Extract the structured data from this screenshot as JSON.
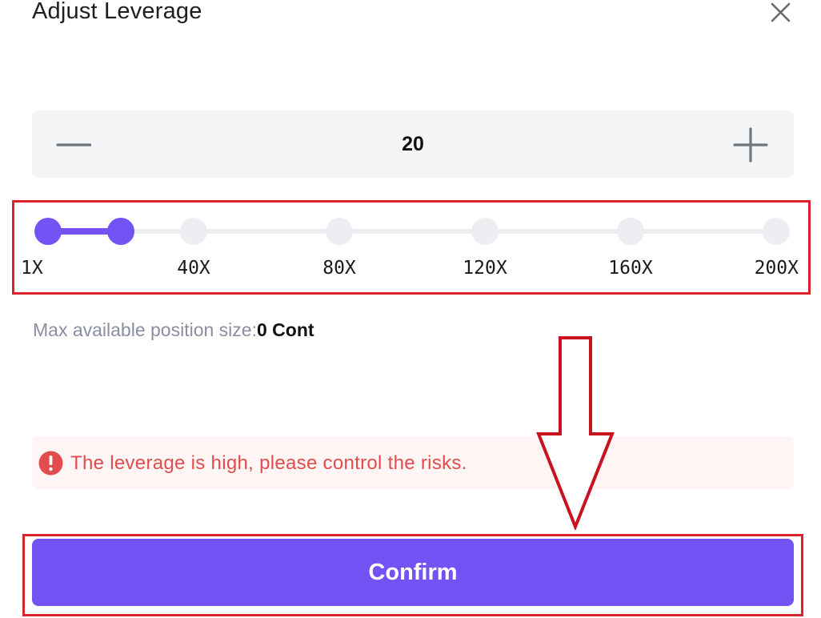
{
  "dialog": {
    "title": "Adjust Leverage",
    "close_icon": "close-icon"
  },
  "stepper": {
    "value": "20",
    "minus_icon": "minus-icon",
    "plus_icon": "plus-icon"
  },
  "slider": {
    "labels": [
      "1X",
      "40X",
      "80X",
      "120X",
      "160X",
      "200X"
    ],
    "current_leverage": 20,
    "accent_color": "#7353f4"
  },
  "position": {
    "label": "Max available position size:",
    "value": "0 Cont"
  },
  "warning": {
    "icon": "exclamation-circle-icon",
    "text": "The leverage is high, please control the risks.",
    "color": "#e24c4c"
  },
  "actions": {
    "confirm_label": "Confirm"
  },
  "annotations": {
    "highlight_color": "#d9232e",
    "arrow_icon": "down-arrow-icon"
  }
}
